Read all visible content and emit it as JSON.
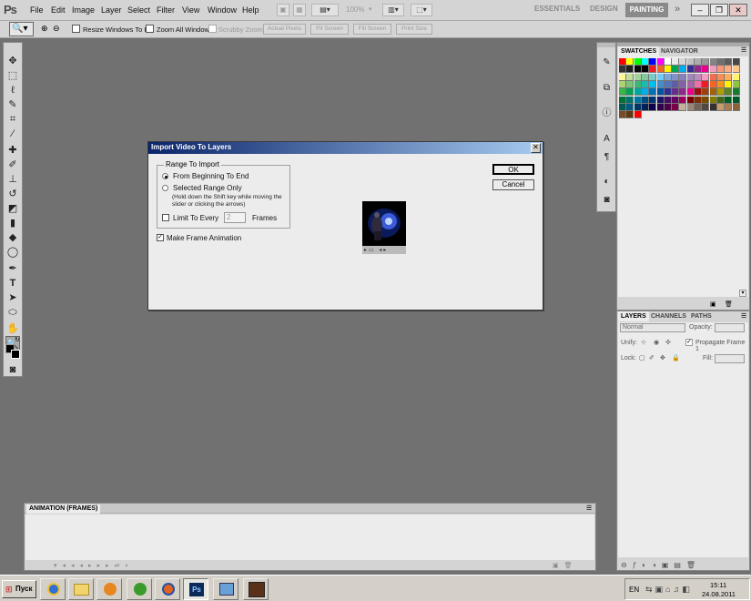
{
  "app": {
    "logo": "Ps"
  },
  "menu": {
    "items": [
      "File",
      "Edit",
      "Image",
      "Layer",
      "Select",
      "Filter",
      "View",
      "Window",
      "Help"
    ]
  },
  "menubar_controls": {
    "zoom_value": "100%"
  },
  "workspaces": {
    "essentials": "ESSENTIALS",
    "design": "DESIGN",
    "painting": "PAINTING",
    "more": "»"
  },
  "options_bar": {
    "resize_windows": "Resize Windows To Fit",
    "zoom_all": "Zoom All Windows",
    "scrubby_zoom": "Scrubby Zoom",
    "actual_pixels": "Actual Pixels",
    "fit_screen": "Fit Screen",
    "fill_screen": "Fill Screen",
    "print_size": "Print Size"
  },
  "swatches_panel": {
    "tab_swatches": "SWATCHES",
    "tab_navigator": "NAVIGATOR"
  },
  "layers_panel": {
    "tab_layers": "LAYERS",
    "tab_channels": "CHANNELS",
    "tab_paths": "PATHS",
    "blend_mode": "Normal",
    "opacity_label": "Opacity:",
    "unify_label": "Unify:",
    "propagate_label": "Propagate Frame 1",
    "lock_label": "Lock:",
    "fill_label": "Fill:"
  },
  "animation_panel": {
    "title": "ANIMATION (FRAMES)"
  },
  "dialog": {
    "title": "Import Video To Layers",
    "ok": "OK",
    "cancel": "Cancel",
    "range_group_title": "Range To Import",
    "option_beginning": "From Beginning To End",
    "option_selected": "Selected Range Only",
    "hint_line1": "(Hold down the Shift key while moving the",
    "hint_line2": "slider or clicking the arrows)",
    "limit_label": "Limit To Every",
    "limit_value": "2",
    "frames_label": "Frames",
    "make_animation": "Make Frame Animation"
  },
  "taskbar": {
    "start": "Пуск",
    "lang": "EN",
    "time": "15:11",
    "date": "24.08.2011"
  },
  "colors": {
    "title_gradient_start": "#0a246a",
    "title_gradient_end": "#a6caf0",
    "workspace_active": "#8a8a8a",
    "swatch_rows": [
      [
        "#ff0000",
        "#ffff00",
        "#00ff00",
        "#00ffff",
        "#0000ff",
        "#ff00ff",
        "#ffffff",
        "#ebebeb",
        "#d6d6d6",
        "#c2c2c2",
        "#adadad",
        "#999999",
        "#858585",
        "#707070",
        "#5c5c5c",
        "#474747"
      ],
      [
        "#333333",
        "#1f1f1f",
        "#0a0a0a",
        "#000000",
        "#ee1d24",
        "#f26522",
        "#fff200",
        "#00a651",
        "#00aeef",
        "#2e3192",
        "#92278f",
        "#ec008c",
        "#f49ac1",
        "#f7977a",
        "#fbad82",
        "#fdc68c"
      ],
      [
        "#fff799",
        "#c4df9b",
        "#a3d39c",
        "#82ca9c",
        "#7accc8",
        "#6dcff6",
        "#7da7d9",
        "#8393ca",
        "#8781bd",
        "#a187be",
        "#bd8cbf",
        "#f49ac2",
        "#f26c4f",
        "#f68e56",
        "#fbaf5d",
        "#fff467"
      ],
      [
        "#acd372",
        "#7cc576",
        "#3bb878",
        "#1abbb4",
        "#00bff3",
        "#448ccb",
        "#5574b9",
        "#605ca8",
        "#8560a8",
        "#a864a8",
        "#f06eaa",
        "#ed1c24",
        "#f26522",
        "#f7941d",
        "#fff200",
        "#8dc63f"
      ],
      [
        "#39b54a",
        "#00a651",
        "#00a99d",
        "#00aeef",
        "#0072bc",
        "#0054a6",
        "#2e3192",
        "#662d91",
        "#92278f",
        "#ec008c",
        "#9e0b0f",
        "#a0410d",
        "#a36209",
        "#aba000",
        "#598527",
        "#197b30"
      ],
      [
        "#007236",
        "#00746b",
        "#0076a3",
        "#004b80",
        "#003471",
        "#1b1464",
        "#440e62",
        "#630460",
        "#9e005d",
        "#790000",
        "#7b2e00",
        "#7d4900",
        "#827b00",
        "#406618",
        "#005e20",
        "#005826"
      ],
      [
        "#005952",
        "#005b7f",
        "#003663",
        "#002157",
        "#0d004c",
        "#32004b",
        "#4b0049",
        "#7b0046",
        "#c7b299",
        "#998675",
        "#736357",
        "#534741",
        "#37302d",
        "#c69c6d",
        "#a67c52",
        "#8c6239"
      ],
      [
        "#754c24",
        "#603913",
        "#ff0000"
      ]
    ]
  }
}
